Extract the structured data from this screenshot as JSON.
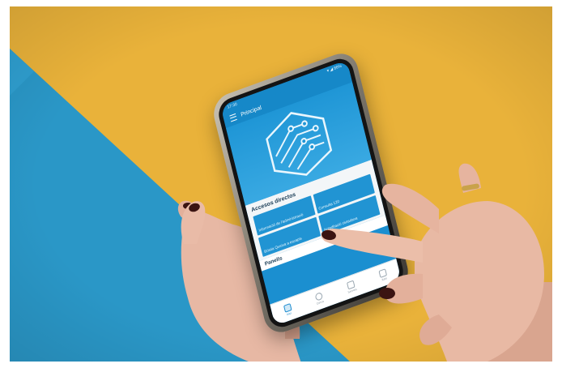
{
  "phone": {
    "status_time": "17:30",
    "status_right": "▾ ◢ 86%",
    "appbar_title": "Principal",
    "section_title": "Accesos directos",
    "tiles": [
      {
        "label": "Informació de l'administració"
      },
      {
        "label": "Consulta 120"
      },
      {
        "label": "Bústia Queixa a escapis"
      },
      {
        "label": "Acreditació ciutadana"
      }
    ],
    "section2_title": "Panells",
    "nav": [
      {
        "label": "Inici",
        "icon": "home-icon"
      },
      {
        "label": "Cerca",
        "icon": "search-icon"
      },
      {
        "label": "Serveis",
        "icon": "camera-icon"
      },
      {
        "label": "Xats",
        "icon": "chat-icon"
      }
    ]
  },
  "colors": {
    "background_yellow": "#e9b23a",
    "background_blue": "#2a97c7",
    "app_blue": "#1b8fd0",
    "nail_polish": "#3b1412"
  }
}
